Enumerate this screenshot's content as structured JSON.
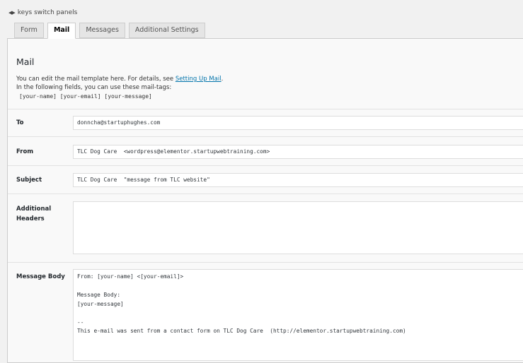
{
  "hint": {
    "text": "keys switch panels",
    "icon": "arrows-left-right-icon"
  },
  "tabs": [
    {
      "label": "Form",
      "active": false
    },
    {
      "label": "Mail",
      "active": true
    },
    {
      "label": "Messages",
      "active": false
    },
    {
      "label": "Additional Settings",
      "active": false
    }
  ],
  "panel": {
    "title": "Mail",
    "desc_line1_prefix": "You can edit the mail template here. For details, see ",
    "desc_link": "Setting Up Mail",
    "desc_line1_suffix": ".",
    "desc_line2": "In the following fields, you can use these mail-tags:",
    "mail_tags": "[your-name] [your-email] [your-message]"
  },
  "fields": {
    "to": {
      "label": "To",
      "value": "donncha@startuphughes.com"
    },
    "from": {
      "label": "From",
      "value": "TLC Dog Care  <wordpress@elementor.startupwebtraining.com>"
    },
    "subject": {
      "label": "Subject",
      "value": "TLC Dog Care  \"message from TLC website\""
    },
    "headers": {
      "label_line1": "Additional",
      "label_line2": "Headers",
      "value": ""
    },
    "body": {
      "label": "Message Body",
      "value": "From: [your-name] <[your-email]>\n\nMessage Body:\n[your-message]\n\n--\nThis e-mail was sent from a contact form on TLC Dog Care  (http://elementor.startupwebtraining.com)"
    }
  }
}
